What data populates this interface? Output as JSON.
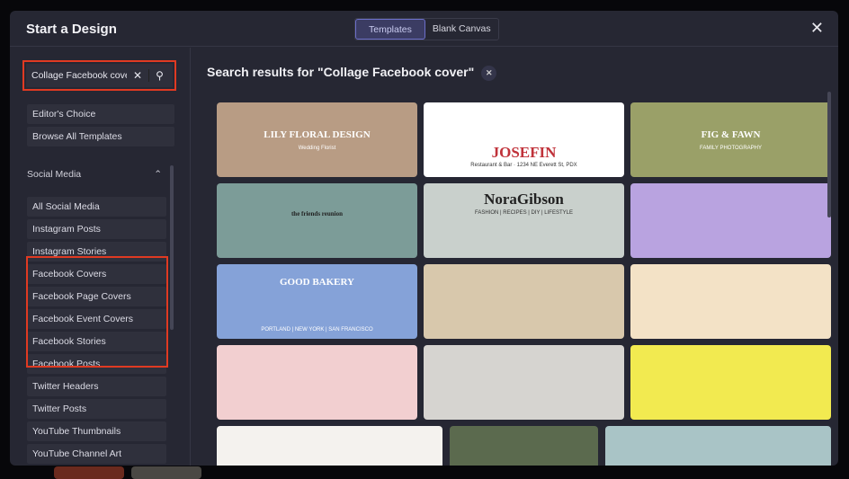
{
  "dialog": {
    "title": "Start a Design",
    "tabs": [
      {
        "label": "Templates",
        "active": true
      },
      {
        "label": "Blank Canvas",
        "active": false
      }
    ],
    "close_icon": "close-icon"
  },
  "sidebar": {
    "search": {
      "value": "Collage Facebook cover",
      "clear_icon": "close-icon",
      "search_icon": "search-icon"
    },
    "top_items": [
      "Editor's Choice",
      "Browse All Templates"
    ],
    "section": {
      "label": "Social Media",
      "expanded": true,
      "items": [
        "All Social Media",
        "Instagram Posts",
        "Instagram Stories",
        "Facebook Covers",
        "Facebook Page Covers",
        "Facebook Event Covers",
        "Facebook Stories",
        "Facebook Posts",
        "Twitter Headers",
        "Twitter Posts",
        "YouTube Thumbnails",
        "YouTube Channel Art"
      ]
    }
  },
  "results": {
    "title": "Search results for \"Collage Facebook cover\"",
    "templates": [
      {
        "text": "LILY FLORAL DESIGN",
        "sub": "Wedding Florist",
        "bg": "#b89c84"
      },
      {
        "text": "JOSEFIN",
        "sub": "Restaurant & Bar · 1234 NE Everett St, PDX",
        "bg": "#ffffff"
      },
      {
        "text": "FIG & FAWN",
        "sub": "FAMILY PHOTOGRAPHY",
        "bg": "#9aa068"
      },
      {
        "text": "the friends reunion",
        "bg": "#7c9c98"
      },
      {
        "text": "NoraGibson",
        "sub": "FASHION | RECIPES | DIY | LIFESTYLE",
        "bg": "#c9d0cc"
      },
      {
        "text": "",
        "bg": "#b9a3e0"
      },
      {
        "text": "GOOD BAKERY",
        "sub": "PORTLAND | NEW YORK | SAN FRANCISCO",
        "bg": "#85a2d8"
      },
      {
        "text": "",
        "bg": "#d8c8ac"
      },
      {
        "text": "",
        "bg": "#f3e2c6"
      },
      {
        "text": "",
        "bg": "#f2cfd0"
      },
      {
        "text": "",
        "bg": "#d6d4d0"
      },
      {
        "text": "",
        "bg": "#f2ea50"
      },
      {
        "text": "",
        "bg": "#f4f2ee"
      },
      {
        "text": "",
        "bg": "#5b6a4e"
      },
      {
        "text": "",
        "bg": "#a9c4c6"
      }
    ]
  },
  "colors": {
    "highlight": "#e03a22",
    "accent": "#6c6fc9"
  }
}
